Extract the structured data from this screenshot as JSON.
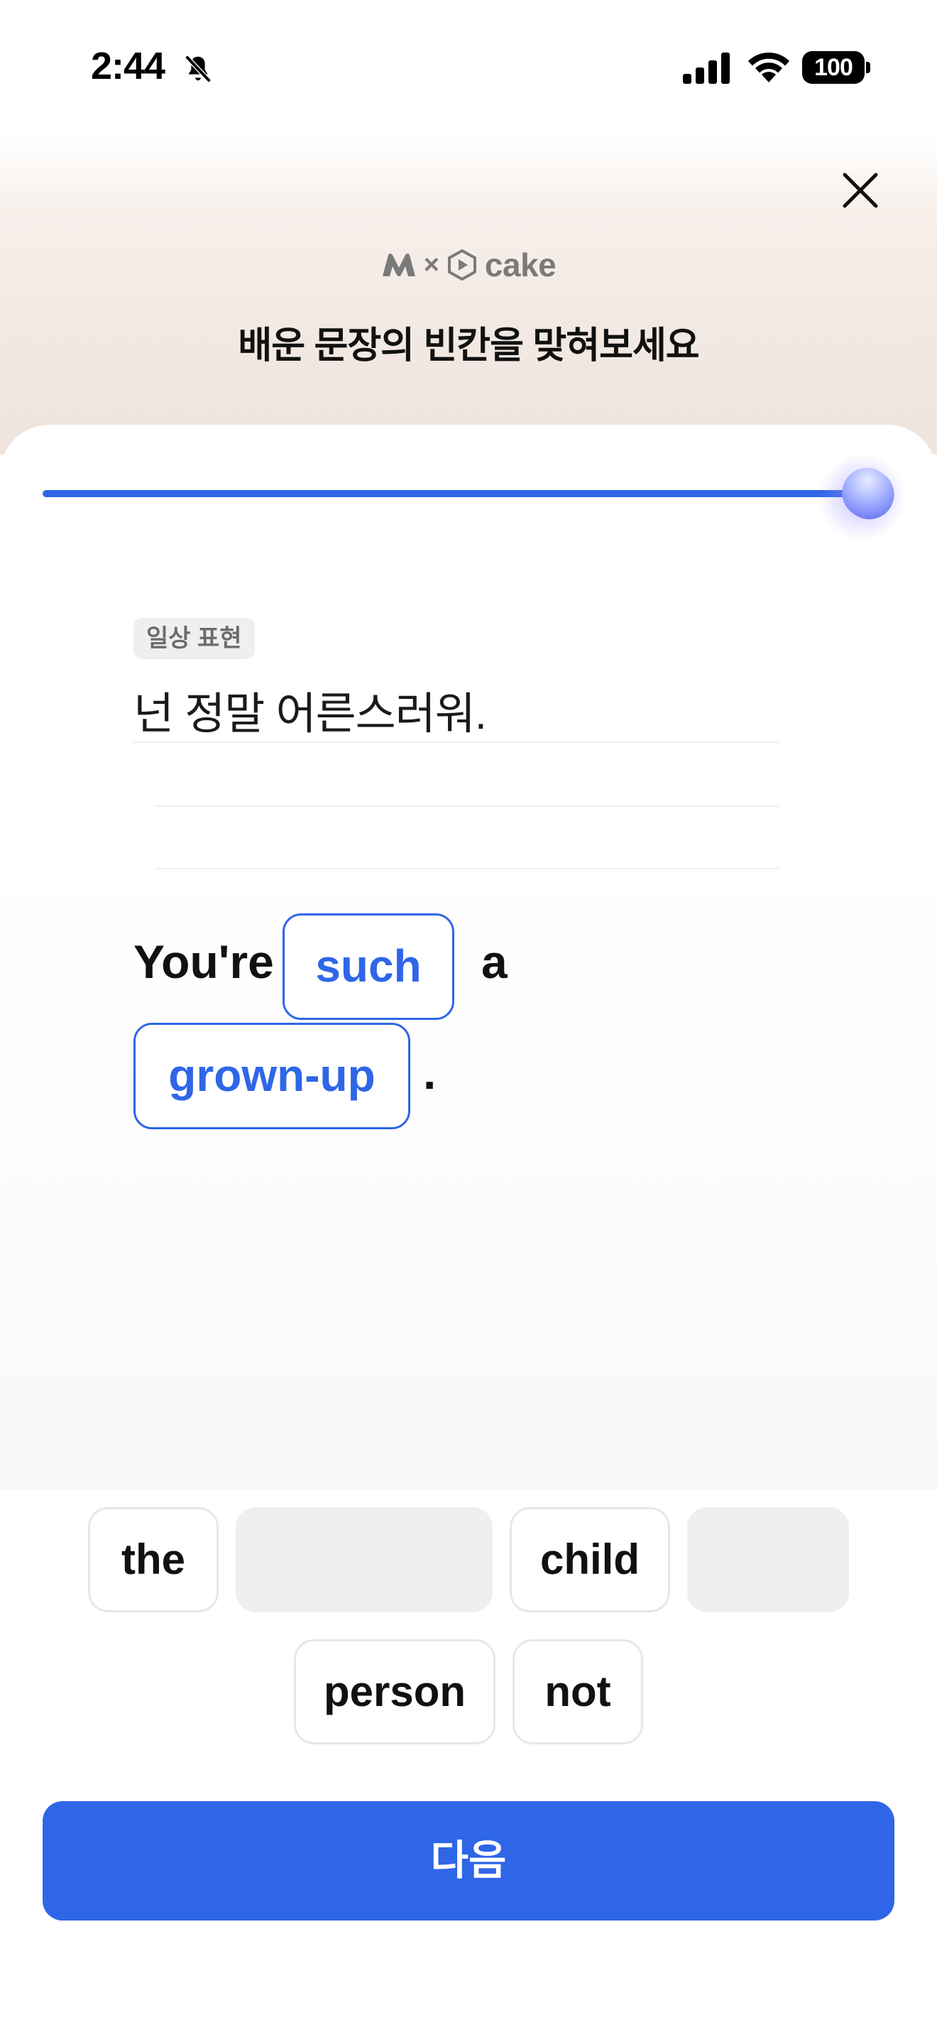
{
  "status_bar": {
    "time": "2:44",
    "battery": "100"
  },
  "header": {
    "brand_name": "cake",
    "brand_separator": "×",
    "title": "배운 문장의 빈칸을 맞혀보세요"
  },
  "progress": {
    "value": 1.0
  },
  "question": {
    "category_badge": "일상 표현",
    "korean": "넌 정말 어른스러워.",
    "sentence_parts": {
      "word_1": "You're",
      "blank_1": "such",
      "word_2": "a",
      "blank_2": "grown-up",
      "end": "."
    }
  },
  "options": {
    "row1": [
      "the",
      "",
      "child",
      ""
    ],
    "row2": [
      "person",
      "not"
    ]
  },
  "footer": {
    "next_label": "다음"
  },
  "colors": {
    "accent": "#2f66e8",
    "header_bg": "#efe4de",
    "chip_empty": "#efefef"
  }
}
